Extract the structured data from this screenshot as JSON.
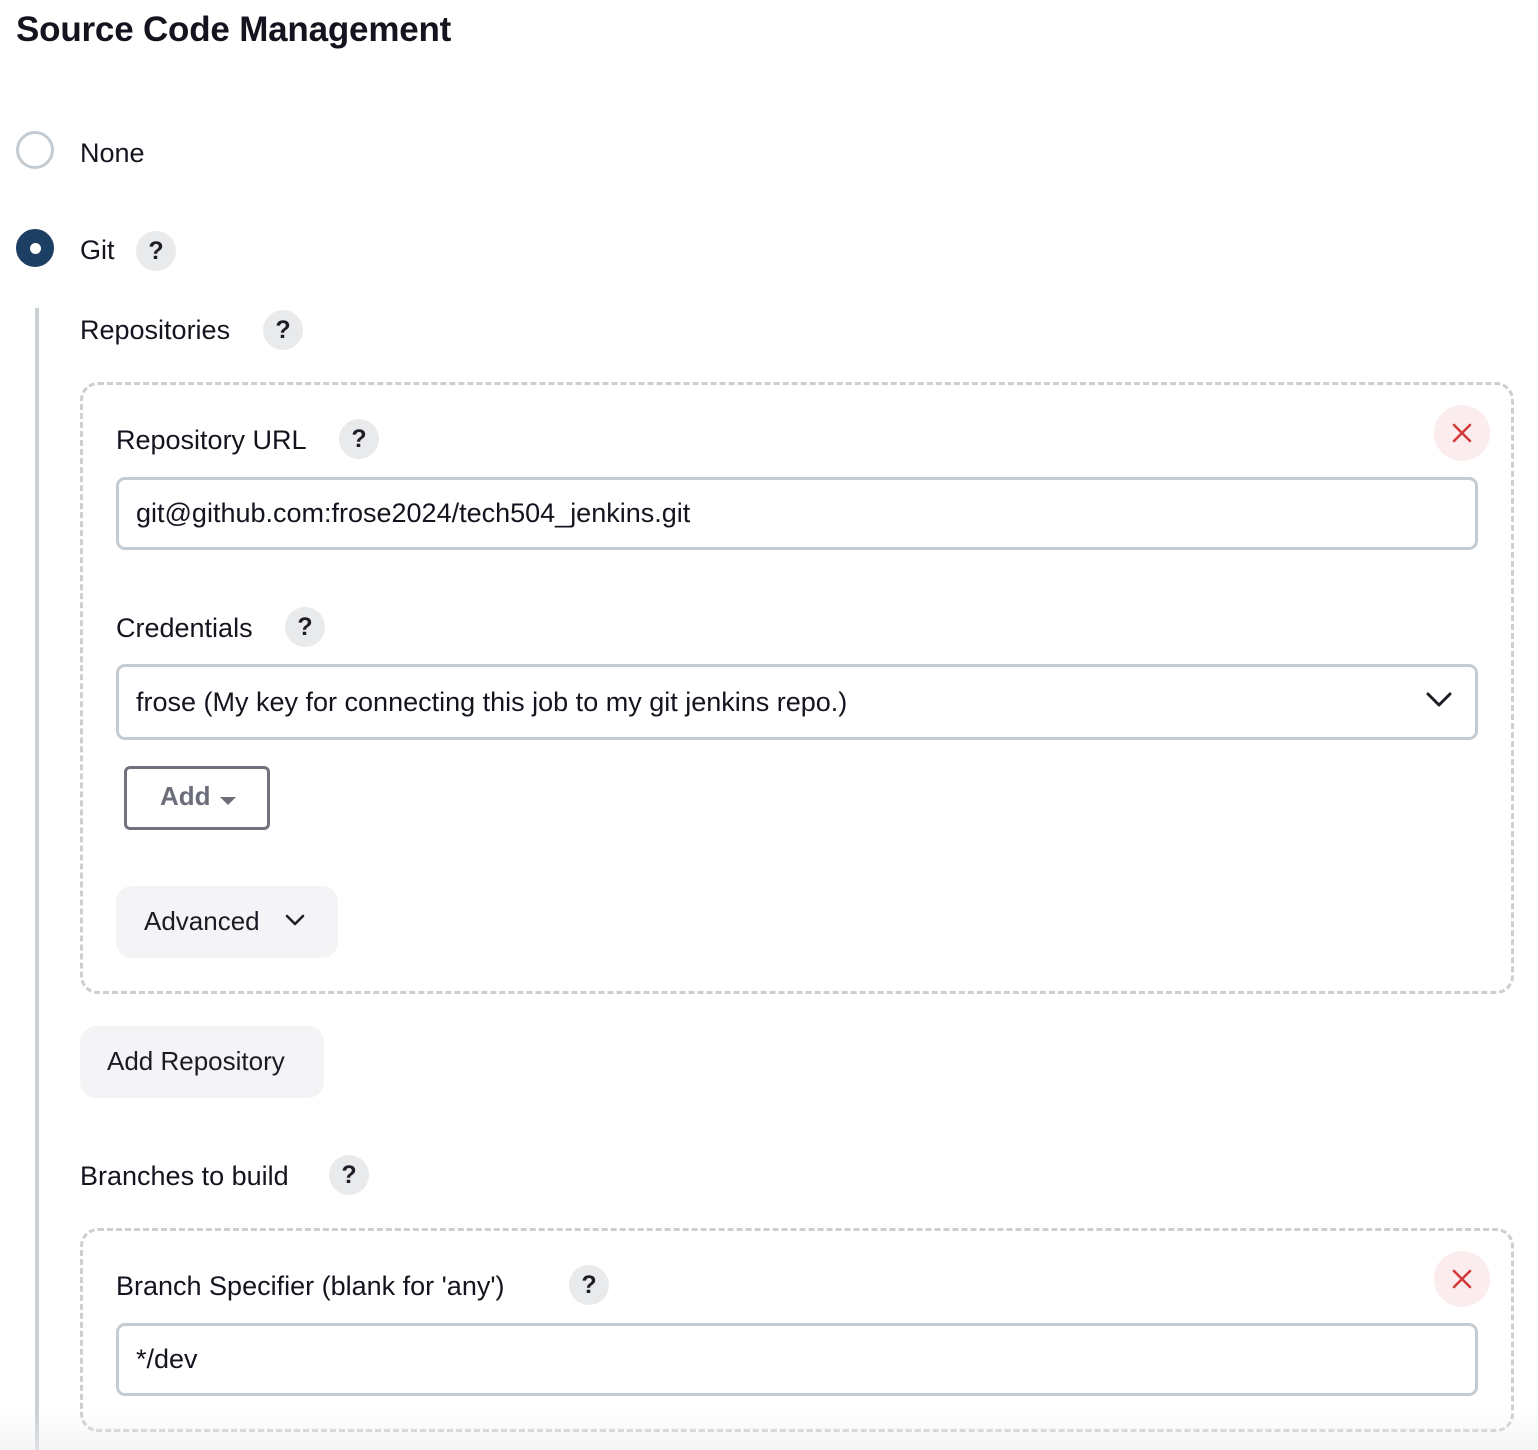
{
  "section": {
    "title": "Source Code Management"
  },
  "scm": {
    "options": [
      {
        "label": "None",
        "selected": false
      },
      {
        "label": "Git",
        "selected": true
      }
    ],
    "help_icon": "question-mark-icon"
  },
  "git": {
    "repositories_label": "Repositories",
    "repository": {
      "url_label": "Repository URL",
      "url_value": "git@github.com:frose2024/tech504_jenkins.git",
      "credentials_label": "Credentials",
      "credentials_selected": "frose (My key for connecting this job to my git jenkins repo.)",
      "add_label": "Add",
      "advanced_label": "Advanced"
    },
    "add_repository_label": "Add Repository",
    "branches_label": "Branches to build",
    "branch": {
      "specifier_label": "Branch Specifier (blank for 'any')",
      "specifier_value": "*/dev"
    }
  },
  "colors": {
    "accent": "#1d3f63",
    "delete_icon": "#d33a3a",
    "delete_bg": "#fbeced",
    "border": "#c5ccd1"
  }
}
